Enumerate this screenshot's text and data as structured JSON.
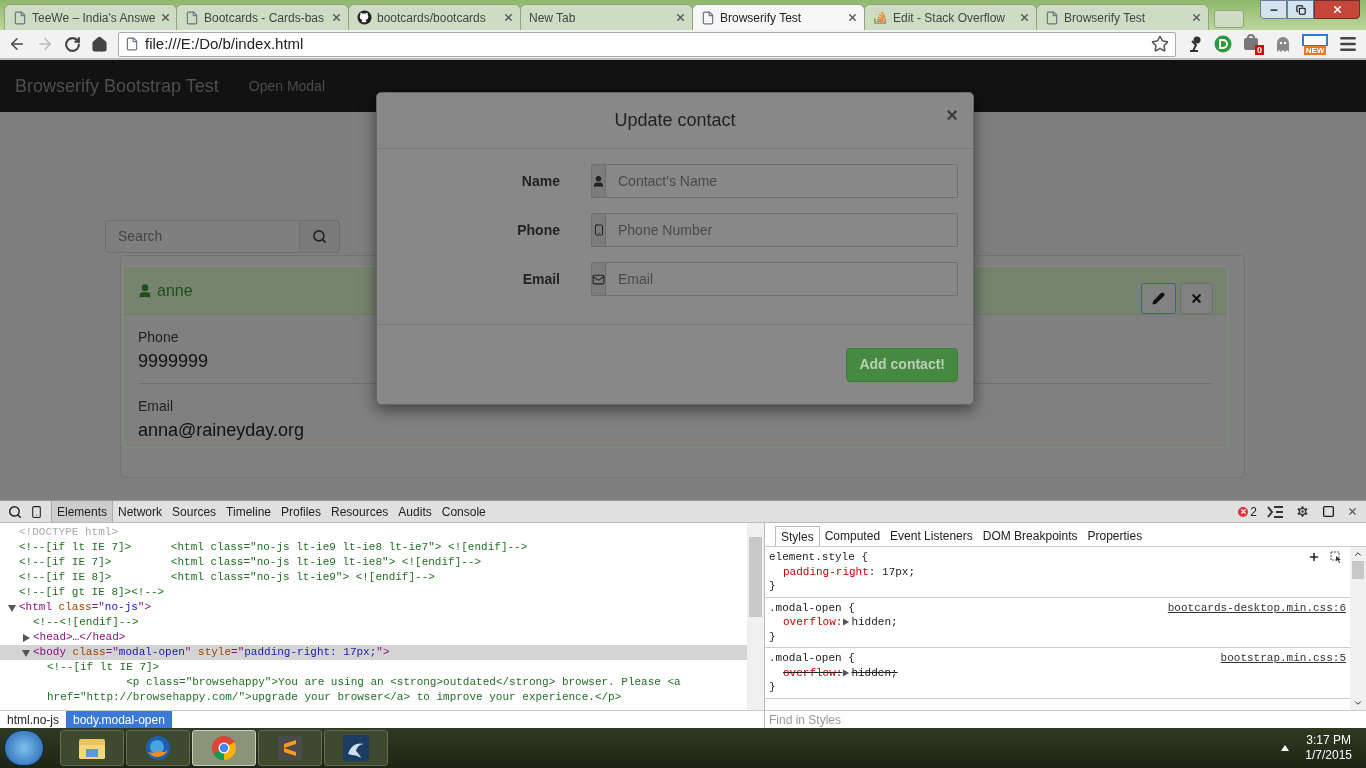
{
  "browser": {
    "tabs": [
      {
        "title": "TeeWe – India's Answe",
        "kind": "page",
        "selected": false
      },
      {
        "title": "Bootcards - Cards-bas",
        "kind": "page",
        "selected": false
      },
      {
        "title": "bootcards/bootcards",
        "kind": "github",
        "selected": false
      },
      {
        "title": "New Tab",
        "kind": "blank",
        "selected": false
      },
      {
        "title": "Browserify Test",
        "kind": "page",
        "selected": true
      },
      {
        "title": "Edit - Stack Overflow",
        "kind": "stack",
        "selected": false
      },
      {
        "title": "Browserify Test",
        "kind": "page",
        "selected": false
      }
    ],
    "address": "file:///E:/Do/b/index.html",
    "back_disabled": false,
    "forward_disabled": true,
    "extension_badge": "0",
    "new_badge": "NEW"
  },
  "page": {
    "navbar": {
      "brand": "Browserify Bootstrap Test",
      "link": "Open Modal"
    },
    "search": {
      "placeholder": "Search"
    },
    "contact": {
      "name": "anne",
      "fields": [
        {
          "label": "Phone",
          "value": "9999999"
        },
        {
          "label": "Email",
          "value": "anna@raineyday.org"
        }
      ]
    },
    "modal": {
      "title": "Update contact",
      "close": "×",
      "fields": [
        {
          "label": "Name",
          "placeholder": "Contact's Name",
          "kind": "user"
        },
        {
          "label": "Phone",
          "placeholder": "Phone Number",
          "kind": "phone"
        },
        {
          "label": "Email",
          "placeholder": "Email",
          "kind": "mail"
        }
      ],
      "submit": "Add contact!"
    }
  },
  "devtools": {
    "tabs": [
      {
        "label": "Elements",
        "selected": true
      },
      {
        "label": "Network",
        "selected": false
      },
      {
        "label": "Sources",
        "selected": false
      },
      {
        "label": "Timeline",
        "selected": false
      },
      {
        "label": "Profiles",
        "selected": false
      },
      {
        "label": "Resources",
        "selected": false
      },
      {
        "label": "Audits",
        "selected": false
      },
      {
        "label": "Console",
        "selected": false
      }
    ],
    "error_count": "2",
    "dom": [
      {
        "segments": [
          {
            "kind": "doctype",
            "text": "<!DOCTYPE html>"
          }
        ]
      },
      {
        "segments": [
          {
            "kind": "comment",
            "text": "<!--[if lt IE 7]>      <html class=\"no-js lt-ie9 lt-ie8 lt-ie7\"> <![endif]-->"
          }
        ]
      },
      {
        "segments": [
          {
            "kind": "comment",
            "text": "<!--[if IE 7]>         <html class=\"no-js lt-ie9 lt-ie8\"> <![endif]-->"
          }
        ]
      },
      {
        "segments": [
          {
            "kind": "comment",
            "text": "<!--[if IE 8]>         <html class=\"no-js lt-ie9\"> <![endif]-->"
          }
        ]
      },
      {
        "segments": [
          {
            "kind": "comment",
            "text": "<!--[if gt IE 8]><!-->"
          }
        ]
      },
      {
        "segments": [
          {
            "kind": "tag",
            "text": "<html "
          },
          {
            "kind": "attr",
            "text": "class"
          },
          {
            "kind": "tag",
            "text": "=\""
          },
          {
            "kind": "value",
            "text": "no-js"
          },
          {
            "kind": "tag",
            "text": "\">"
          }
        ],
        "expanded": true,
        "selected": false,
        "children": [
          {
            "segments": [
              {
                "kind": "comment",
                "text": "<!--<![endif]-->"
              }
            ]
          },
          {
            "segments": [
              {
                "kind": "tag",
                "text": "<head>"
              },
              {
                "kind": "plain",
                "text": "…"
              },
              {
                "kind": "tag",
                "text": "</head>"
              }
            ],
            "expanded": false,
            "selected": false
          },
          {
            "segments": [
              {
                "kind": "tag",
                "text": "<body "
              },
              {
                "kind": "attr",
                "text": "class"
              },
              {
                "kind": "tag",
                "text": "=\""
              },
              {
                "kind": "value",
                "text": "modal-open"
              },
              {
                "kind": "tag",
                "text": "\" "
              },
              {
                "kind": "attr",
                "text": "style"
              },
              {
                "kind": "tag",
                "text": "=\""
              },
              {
                "kind": "value",
                "text": "padding-right: 17px;"
              },
              {
                "kind": "tag",
                "text": "\">"
              }
            ],
            "expanded": true,
            "selected": true,
            "children": [
              {
                "segments": [
                  {
                    "kind": "comment",
                    "text": "<!--[if lt IE 7]>"
                  }
                ]
              },
              {
                "segments": [
                  {
                    "kind": "comment",
                    "text": "            <p class=\"browsehappy\">You are using an <strong>outdated</strong> browser. Please <a href=\"http://browsehappy.com/\">upgrade your browser</a> to improve your experience.</p>"
                  }
                ]
              }
            ]
          }
        ]
      }
    ],
    "breadcrumbs": [
      {
        "label": "html.no-js",
        "selected": false
      },
      {
        "label": "body.modal-open",
        "selected": true
      }
    ],
    "sidebar_tabs": [
      {
        "label": "Styles",
        "selected": true
      },
      {
        "label": "Computed",
        "selected": false
      },
      {
        "label": "Event Listeners",
        "selected": false
      },
      {
        "label": "DOM Breakpoints",
        "selected": false
      },
      {
        "label": "Properties",
        "selected": false
      }
    ],
    "rules": [
      {
        "selector": "element.style {",
        "declarations": [
          {
            "property": "padding-right",
            "colon": ":",
            "value": "17px;",
            "expandable": false,
            "overridden": false
          }
        ],
        "close": "}"
      },
      {
        "selector": ".modal-open {",
        "source": "bootcards-desktop.min.css:6",
        "declarations": [
          {
            "property": "overflow:",
            "value": "hidden;",
            "expandable": true,
            "overridden": false
          }
        ],
        "close": "}"
      },
      {
        "selector": ".modal-open {",
        "source": "bootstrap.min.css:5",
        "declarations": [
          {
            "property": "overflow:",
            "value": "hidden;",
            "expandable": true,
            "overridden": true
          }
        ],
        "close": "}"
      }
    ],
    "filter_placeholder": "Find in Styles"
  },
  "taskbar": {
    "apps": [
      {
        "kind": "explorer",
        "selected": false
      },
      {
        "kind": "firefox",
        "selected": false
      },
      {
        "kind": "chrome",
        "selected": true
      },
      {
        "kind": "sublime",
        "selected": false
      },
      {
        "kind": "mysql",
        "selected": false
      }
    ],
    "time": "3:17 PM",
    "date": "1/7/2015"
  }
}
